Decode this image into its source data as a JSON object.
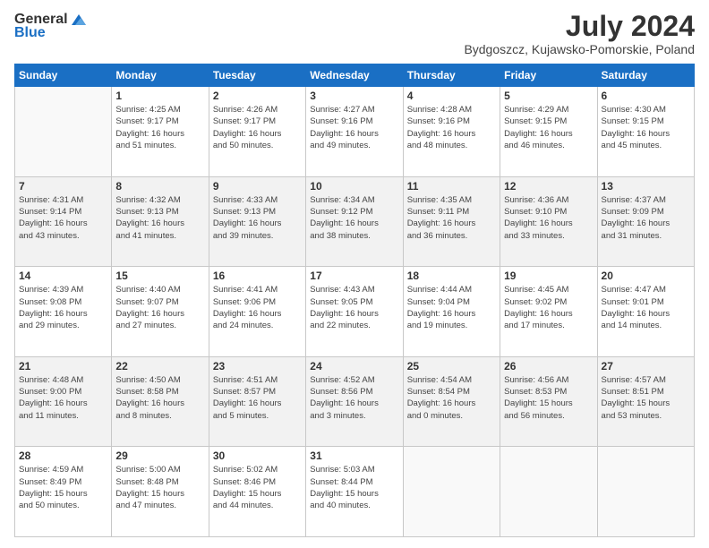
{
  "logo": {
    "general": "General",
    "blue": "Blue"
  },
  "title": "July 2024",
  "subtitle": "Bydgoszcz, Kujawsko-Pomorskie, Poland",
  "weekdays": [
    "Sunday",
    "Monday",
    "Tuesday",
    "Wednesday",
    "Thursday",
    "Friday",
    "Saturday"
  ],
  "weeks": [
    [
      {
        "day": "",
        "info": ""
      },
      {
        "day": "1",
        "info": "Sunrise: 4:25 AM\nSunset: 9:17 PM\nDaylight: 16 hours\nand 51 minutes."
      },
      {
        "day": "2",
        "info": "Sunrise: 4:26 AM\nSunset: 9:17 PM\nDaylight: 16 hours\nand 50 minutes."
      },
      {
        "day": "3",
        "info": "Sunrise: 4:27 AM\nSunset: 9:16 PM\nDaylight: 16 hours\nand 49 minutes."
      },
      {
        "day": "4",
        "info": "Sunrise: 4:28 AM\nSunset: 9:16 PM\nDaylight: 16 hours\nand 48 minutes."
      },
      {
        "day": "5",
        "info": "Sunrise: 4:29 AM\nSunset: 9:15 PM\nDaylight: 16 hours\nand 46 minutes."
      },
      {
        "day": "6",
        "info": "Sunrise: 4:30 AM\nSunset: 9:15 PM\nDaylight: 16 hours\nand 45 minutes."
      }
    ],
    [
      {
        "day": "7",
        "info": "Sunrise: 4:31 AM\nSunset: 9:14 PM\nDaylight: 16 hours\nand 43 minutes."
      },
      {
        "day": "8",
        "info": "Sunrise: 4:32 AM\nSunset: 9:13 PM\nDaylight: 16 hours\nand 41 minutes."
      },
      {
        "day": "9",
        "info": "Sunrise: 4:33 AM\nSunset: 9:13 PM\nDaylight: 16 hours\nand 39 minutes."
      },
      {
        "day": "10",
        "info": "Sunrise: 4:34 AM\nSunset: 9:12 PM\nDaylight: 16 hours\nand 38 minutes."
      },
      {
        "day": "11",
        "info": "Sunrise: 4:35 AM\nSunset: 9:11 PM\nDaylight: 16 hours\nand 36 minutes."
      },
      {
        "day": "12",
        "info": "Sunrise: 4:36 AM\nSunset: 9:10 PM\nDaylight: 16 hours\nand 33 minutes."
      },
      {
        "day": "13",
        "info": "Sunrise: 4:37 AM\nSunset: 9:09 PM\nDaylight: 16 hours\nand 31 minutes."
      }
    ],
    [
      {
        "day": "14",
        "info": "Sunrise: 4:39 AM\nSunset: 9:08 PM\nDaylight: 16 hours\nand 29 minutes."
      },
      {
        "day": "15",
        "info": "Sunrise: 4:40 AM\nSunset: 9:07 PM\nDaylight: 16 hours\nand 27 minutes."
      },
      {
        "day": "16",
        "info": "Sunrise: 4:41 AM\nSunset: 9:06 PM\nDaylight: 16 hours\nand 24 minutes."
      },
      {
        "day": "17",
        "info": "Sunrise: 4:43 AM\nSunset: 9:05 PM\nDaylight: 16 hours\nand 22 minutes."
      },
      {
        "day": "18",
        "info": "Sunrise: 4:44 AM\nSunset: 9:04 PM\nDaylight: 16 hours\nand 19 minutes."
      },
      {
        "day": "19",
        "info": "Sunrise: 4:45 AM\nSunset: 9:02 PM\nDaylight: 16 hours\nand 17 minutes."
      },
      {
        "day": "20",
        "info": "Sunrise: 4:47 AM\nSunset: 9:01 PM\nDaylight: 16 hours\nand 14 minutes."
      }
    ],
    [
      {
        "day": "21",
        "info": "Sunrise: 4:48 AM\nSunset: 9:00 PM\nDaylight: 16 hours\nand 11 minutes."
      },
      {
        "day": "22",
        "info": "Sunrise: 4:50 AM\nSunset: 8:58 PM\nDaylight: 16 hours\nand 8 minutes."
      },
      {
        "day": "23",
        "info": "Sunrise: 4:51 AM\nSunset: 8:57 PM\nDaylight: 16 hours\nand 5 minutes."
      },
      {
        "day": "24",
        "info": "Sunrise: 4:52 AM\nSunset: 8:56 PM\nDaylight: 16 hours\nand 3 minutes."
      },
      {
        "day": "25",
        "info": "Sunrise: 4:54 AM\nSunset: 8:54 PM\nDaylight: 16 hours\nand 0 minutes."
      },
      {
        "day": "26",
        "info": "Sunrise: 4:56 AM\nSunset: 8:53 PM\nDaylight: 15 hours\nand 56 minutes."
      },
      {
        "day": "27",
        "info": "Sunrise: 4:57 AM\nSunset: 8:51 PM\nDaylight: 15 hours\nand 53 minutes."
      }
    ],
    [
      {
        "day": "28",
        "info": "Sunrise: 4:59 AM\nSunset: 8:49 PM\nDaylight: 15 hours\nand 50 minutes."
      },
      {
        "day": "29",
        "info": "Sunrise: 5:00 AM\nSunset: 8:48 PM\nDaylight: 15 hours\nand 47 minutes."
      },
      {
        "day": "30",
        "info": "Sunrise: 5:02 AM\nSunset: 8:46 PM\nDaylight: 15 hours\nand 44 minutes."
      },
      {
        "day": "31",
        "info": "Sunrise: 5:03 AM\nSunset: 8:44 PM\nDaylight: 15 hours\nand 40 minutes."
      },
      {
        "day": "",
        "info": ""
      },
      {
        "day": "",
        "info": ""
      },
      {
        "day": "",
        "info": ""
      }
    ]
  ]
}
